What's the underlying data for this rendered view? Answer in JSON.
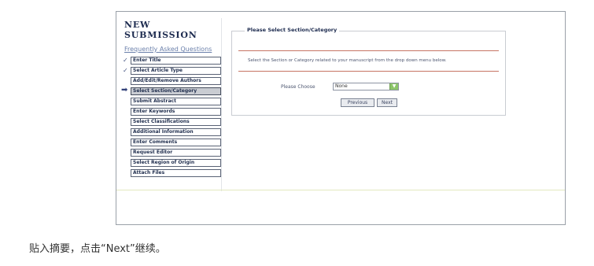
{
  "page": {
    "title": "NEW SUBMISSION",
    "faq_link": "Frequently Asked Questions"
  },
  "steps": [
    {
      "label": "Enter Title",
      "state": "done"
    },
    {
      "label": "Select Article Type",
      "state": "done"
    },
    {
      "label": "Add/Edit/Remove Authors",
      "state": "todo"
    },
    {
      "label": "Select Section/Category",
      "state": "current"
    },
    {
      "label": "Submit Abstract",
      "state": "todo"
    },
    {
      "label": "Enter Keywords",
      "state": "todo"
    },
    {
      "label": "Select Classifications",
      "state": "todo"
    },
    {
      "label": "Additional Information",
      "state": "todo"
    },
    {
      "label": "Enter Comments",
      "state": "todo"
    },
    {
      "label": "Request Editor",
      "state": "todo"
    },
    {
      "label": "Select Region of Origin",
      "state": "todo"
    },
    {
      "label": "Attach Files",
      "state": "todo"
    }
  ],
  "panel": {
    "legend": "Please Select Section/Category",
    "instruction": "Select the Section or Category related to your manuscript from the drop down menu below.",
    "choose_label": "Please Choose",
    "select_value": "None",
    "previous_label": "Previous",
    "next_label": "Next"
  },
  "caption": "贴入摘要，点击“Next”继续。",
  "icons": {
    "done": "check-icon",
    "current": "arrow-right-icon"
  },
  "colors": {
    "accent_red": "#c77464",
    "dropdown_green": "#8dc56a"
  }
}
